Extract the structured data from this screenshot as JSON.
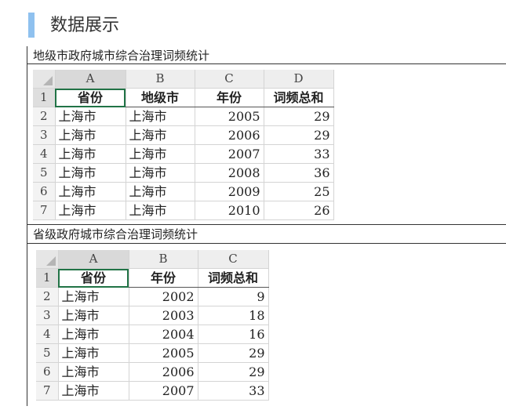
{
  "page": {
    "title": "数据展示"
  },
  "sections": [
    {
      "title": "地级市政府城市综合治理词频统计",
      "columns": [
        "A",
        "B",
        "C",
        "D"
      ],
      "headers": [
        "省份",
        "地级市",
        "年份",
        "词频总和"
      ],
      "rows": [
        [
          "1",
          "上海市",
          "上海市",
          "2005",
          "29"
        ],
        [
          "2",
          "上海市",
          "上海市",
          "2006",
          "29"
        ],
        [
          "3",
          "上海市",
          "上海市",
          "2007",
          "33"
        ],
        [
          "4",
          "上海市",
          "上海市",
          "2008",
          "36"
        ],
        [
          "5",
          "上海市",
          "上海市",
          "2009",
          "25"
        ],
        [
          "6",
          "上海市",
          "上海市",
          "2010",
          "26"
        ]
      ]
    },
    {
      "title": "省级政府城市综合治理词频统计",
      "columns": [
        "A",
        "B",
        "C"
      ],
      "headers": [
        "省份",
        "年份",
        "词频总和"
      ],
      "rows": [
        [
          "1",
          "上海市",
          "2002",
          "9"
        ],
        [
          "2",
          "上海市",
          "2003",
          "18"
        ],
        [
          "3",
          "上海市",
          "2004",
          "16"
        ],
        [
          "4",
          "上海市",
          "2005",
          "29"
        ],
        [
          "5",
          "上海市",
          "2006",
          "29"
        ],
        [
          "6",
          "上海市",
          "2007",
          "33"
        ]
      ]
    }
  ],
  "row_labels": [
    "1",
    "2",
    "3",
    "4",
    "5",
    "6",
    "7"
  ],
  "colors": {
    "accent": "#8fc1ef",
    "selection": "#217346"
  }
}
